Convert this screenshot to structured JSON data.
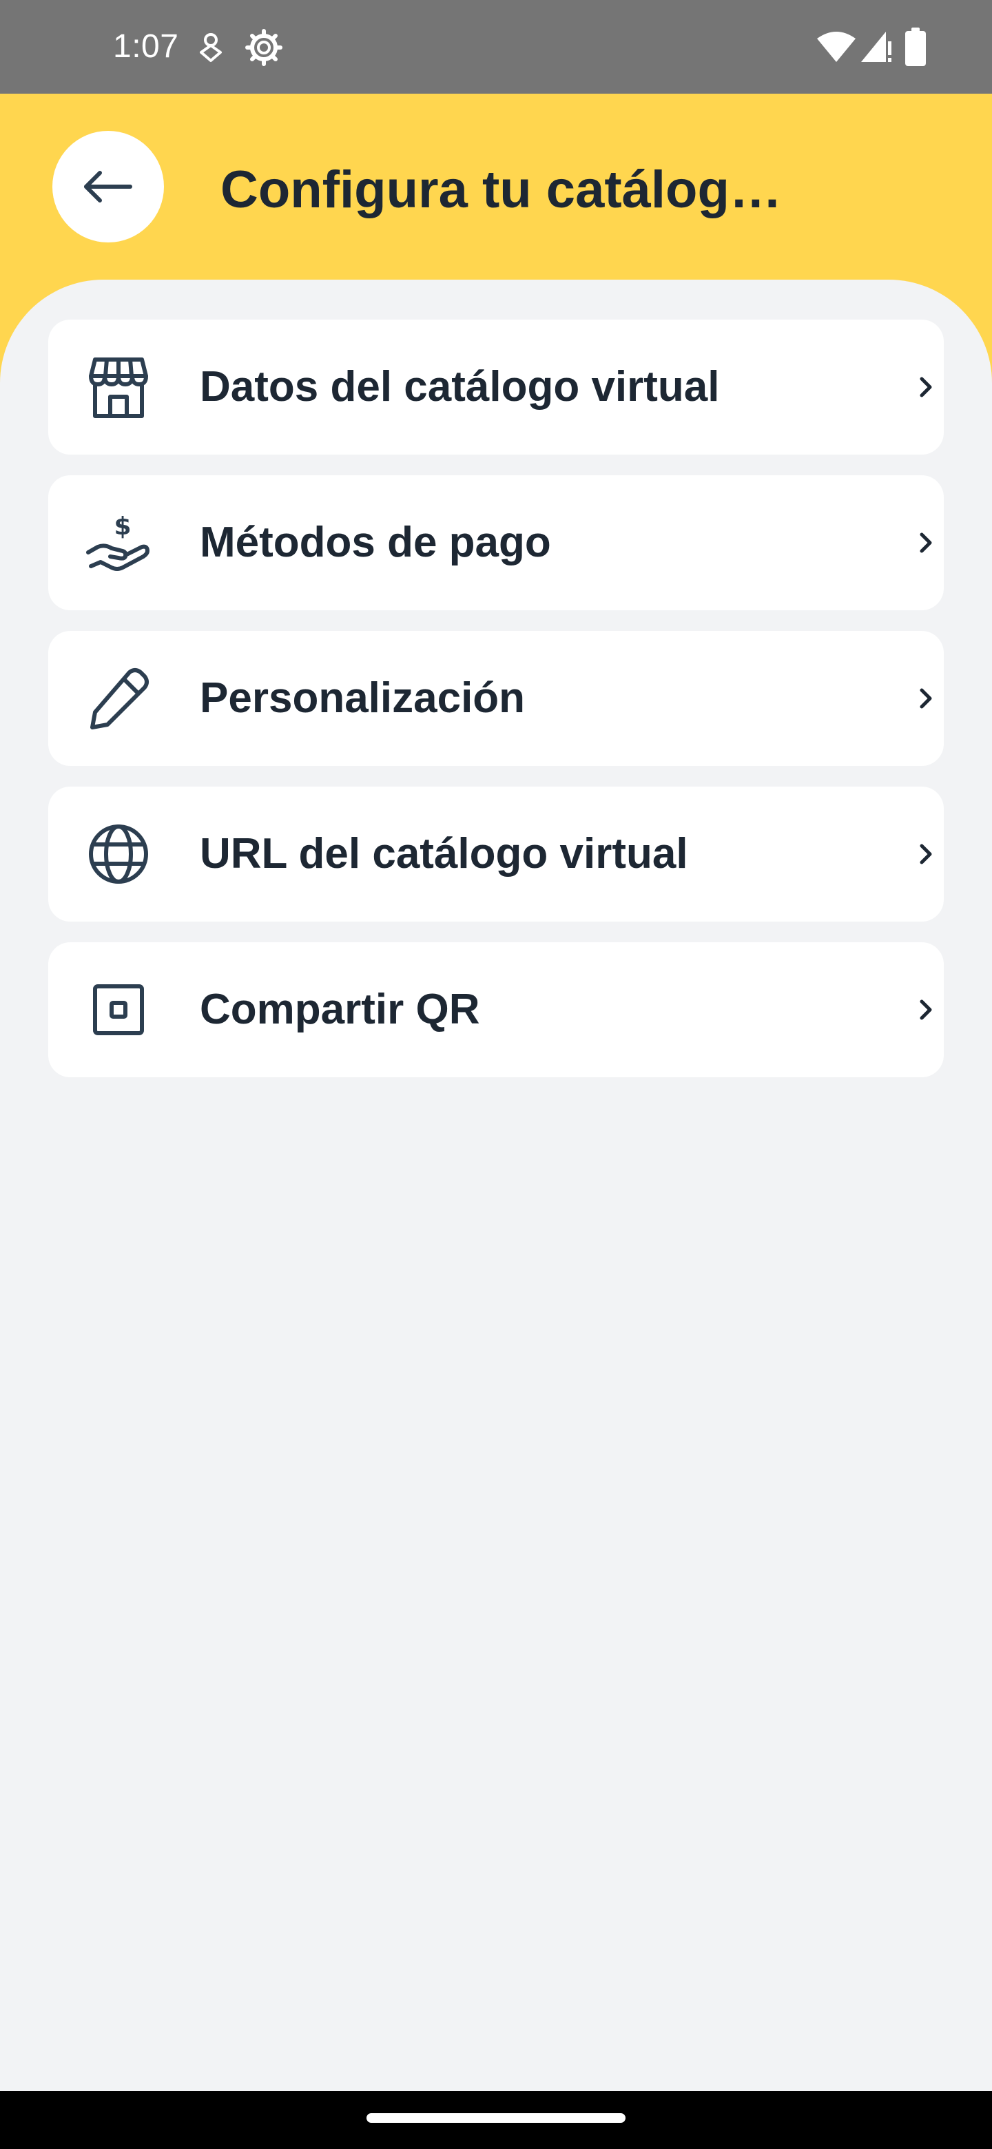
{
  "status_bar": {
    "time": "1:07",
    "icons": [
      "notification-icon",
      "settings-icon",
      "wifi-icon",
      "signal-icon",
      "battery-icon"
    ]
  },
  "header": {
    "back_icon": "arrow-left-icon",
    "title": "Configura tu catálog…",
    "background_color": "#ffd64f"
  },
  "menu": {
    "items": [
      {
        "label": "Datos del catálogo virtual",
        "icon": "storefront-icon"
      },
      {
        "label": "Métodos de pago",
        "icon": "payment-hand-icon"
      },
      {
        "label": "Personalización",
        "icon": "pencil-icon"
      },
      {
        "label": "URL del catálogo virtual",
        "icon": "globe-icon"
      },
      {
        "label": "Compartir QR",
        "icon": "qr-icon"
      }
    ],
    "chevron_icon": "chevron-right-icon"
  },
  "colors": {
    "accent": "#ffd64f",
    "text": "#1d2733",
    "icon": "#2c3e50",
    "background": "#f2f3f5",
    "status_bar": "#757575"
  }
}
